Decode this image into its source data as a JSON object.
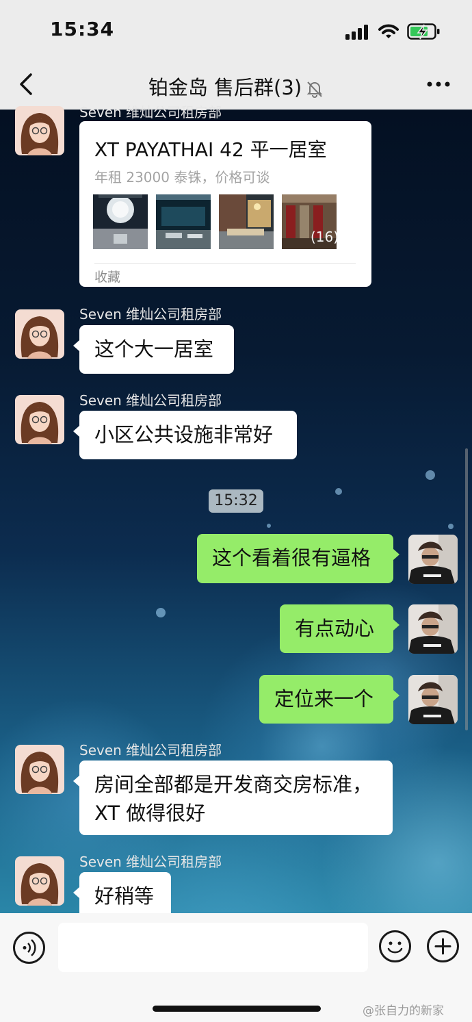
{
  "status_bar": {
    "time": "15:34",
    "icons": [
      "cellular-signal-icon",
      "wifi-icon",
      "battery-charging-icon"
    ]
  },
  "header": {
    "title": "铂金岛 售后群(3)",
    "back_icon": "chevron-left-icon",
    "mute_icon": "bell-slash-icon",
    "more_icon": "ellipsis-icon"
  },
  "card": {
    "title": "XT PAYATHAI 42 平一居室",
    "subtitle": "年租 23000 泰铢，价格可谈",
    "image_count": "(16)",
    "footer": "收藏"
  },
  "messages": [
    {
      "sender": "Seven 维灿公司租房部",
      "text": "这个大一居室"
    },
    {
      "sender": "Seven 维灿公司租房部",
      "text": "小区公共设施非常好"
    },
    {
      "timestamp": "15:32"
    },
    {
      "sender": "me",
      "text": "这个看着很有逼格"
    },
    {
      "sender": "me",
      "text": "有点动心"
    },
    {
      "sender": "me",
      "text": "定位来一个"
    },
    {
      "sender": "Seven 维灿公司租房部",
      "lines": [
        "房间全部都是开发商交房标准，",
        "XT 做得很好"
      ]
    },
    {
      "sender": "Seven 维灿公司租房部",
      "text": "好稍等"
    }
  ],
  "input_bar": {
    "voice_icon": "voice-icon",
    "emoji_icon": "emoji-icon",
    "add_icon": "plus-icon",
    "input_value": ""
  },
  "watermark": "@张自力的新家",
  "colors": {
    "bar_bg": "#ececec",
    "outgoing_bubble": "#95ec69",
    "incoming_bubble": "#ffffff"
  }
}
